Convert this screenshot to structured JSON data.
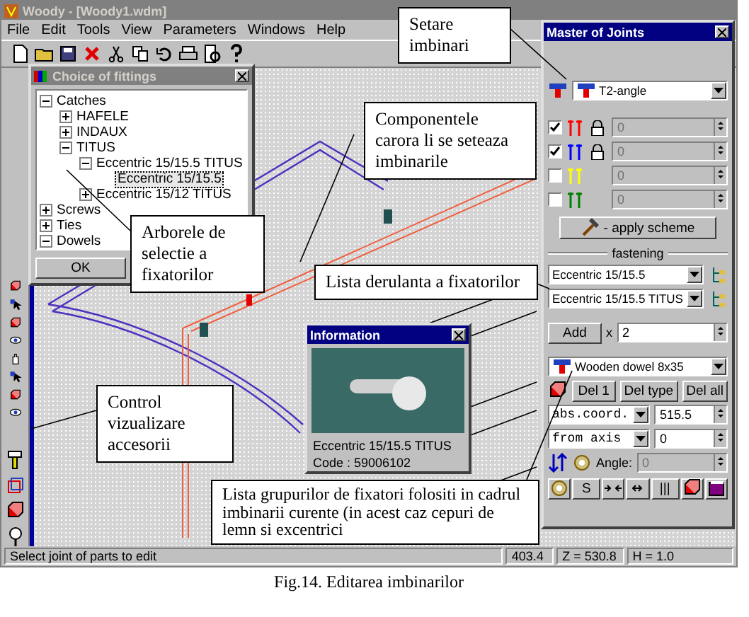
{
  "window": {
    "title": "Woody - [Woody1.wdm]"
  },
  "menu": [
    "File",
    "Edit",
    "Tools",
    "View",
    "Parameters",
    "Windows",
    "Help"
  ],
  "fittings_window": {
    "title": "Choice of fittings",
    "tree": [
      {
        "label": "Catches",
        "expanded": true,
        "selected": false,
        "children": [
          {
            "label": "HAFELE",
            "expanded": false,
            "selected": false
          },
          {
            "label": "INDAUX",
            "expanded": false,
            "selected": false
          },
          {
            "label": "TITUS",
            "expanded": true,
            "selected": false,
            "children": [
              {
                "label": "Eccentric 15/15.5 TITUS",
                "expanded": true,
                "selected": false,
                "children": [
                  {
                    "label": "Eccentric 15/15.5",
                    "selected": true
                  }
                ]
              },
              {
                "label": "Eccentric 15/12 TITUS",
                "expanded": false,
                "selected": false
              }
            ]
          }
        ]
      },
      {
        "label": "Screws",
        "expanded": false,
        "selected": false
      },
      {
        "label": "Ties",
        "expanded": false,
        "selected": false
      },
      {
        "label": "Dowels",
        "expanded": true,
        "selected": false
      }
    ],
    "buttons": [
      "OK"
    ]
  },
  "joints_window": {
    "title": "Master of Joints",
    "joint_type": "T2-angle",
    "layers": [
      {
        "checked": true,
        "color": "#ff0000",
        "locked": true,
        "disabled": true,
        "value": "0"
      },
      {
        "checked": true,
        "color": "#0000ff",
        "locked": true,
        "disabled": true,
        "value": "0"
      },
      {
        "checked": false,
        "color": "#ffff00",
        "locked": false,
        "disabled": true,
        "value": "0"
      },
      {
        "checked": false,
        "color": "#008000",
        "locked": false,
        "disabled": true,
        "value": "0"
      }
    ],
    "apply_button": "- apply scheme",
    "fastening_label": "fastening",
    "fastening_selects": [
      "Eccentric 15/15.5",
      "Eccentric 15/15.5 TITUS"
    ],
    "add_button": "Add",
    "multiplier": "x",
    "count": "2",
    "fitting_group": "Wooden dowel 8x35",
    "delete_buttons": [
      "Del 1",
      "Del type",
      "Del all"
    ],
    "position_rows": [
      {
        "mode": "abs.coord.",
        "value": "515.5"
      },
      {
        "mode": "from axis",
        "value": "0"
      }
    ],
    "angle": {
      "label": "Angle:",
      "value": "0",
      "disabled": true
    },
    "bottom_buttons": [
      {
        "kind": "icon"
      },
      {
        "kind": "text",
        "label": "S"
      },
      {
        "kind": "icon"
      },
      {
        "kind": "icon"
      },
      {
        "kind": "text",
        "label": "|||"
      },
      {
        "kind": "icon"
      },
      {
        "kind": "icon"
      }
    ]
  },
  "info_window": {
    "title": "Information",
    "lines": [
      "Eccentric 15/15.5 TITUS",
      "Code : 59006102"
    ]
  },
  "callouts": [
    {
      "text": "Setare imbinari"
    },
    {
      "text": "Componentele carora li se seteaza imbinarile"
    },
    {
      "text": "Arborele de selectie a fixatorilor"
    },
    {
      "text": "Lista derulanta a fixatorilor"
    },
    {
      "text": "Control vizualizare accesorii"
    },
    {
      "text": "Lista grupurilor de fixatori folositi in cadrul imbinarii curente (in acest caz cepuri de lemn si excentrici"
    }
  ],
  "status_bar": [
    "Select joint of parts to edit",
    "403.4",
    "Z = 530.8",
    "H = 1.0"
  ],
  "caption": "Fig.14. Editarea imbinarilor"
}
